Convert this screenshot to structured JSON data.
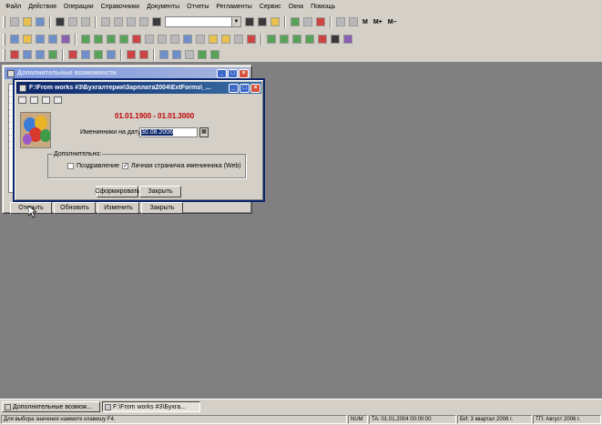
{
  "menubar": {
    "items": [
      "Файл",
      "Действия",
      "Операции",
      "Справочники",
      "Документы",
      "Отчеты",
      "Регламенты",
      "Сервис",
      "Окна",
      "Помощь"
    ]
  },
  "toolbar": {
    "m_label": "M",
    "m_plus_label": "M+",
    "m_minus_label": "M–"
  },
  "back_window": {
    "title": "Дополнительные возможности",
    "buttons": [
      "Открыть",
      "Обновить",
      "Изменить",
      "Закрыть"
    ]
  },
  "dialog": {
    "title": "F:\\From works #3\\Бухгалтерия\\Зарплата2004\\ExtForms\\_...",
    "date_range": "01.01.1900 - 01.01.3000",
    "birthday_label": "Именинники на дату:",
    "date_value": "30.08.2006",
    "group_label": "Дополнительно:",
    "greeting_label": "Поздравление",
    "greeting_checked": false,
    "personal_page_label": "Личная страничка именинника (Web)",
    "personal_page_checked": true,
    "form_button": "Сформировать",
    "close_button": "Закрыть"
  },
  "taskbar": {
    "items": [
      "Дополнительные возмож...",
      "F:\\From works #3\\Бухга..."
    ]
  },
  "statusbar": {
    "hint": "Для выбора значения нажмите клавишу F4.",
    "num": "NUM",
    "ta": "TA: 01.01.2004  00:00:00",
    "bi": "БИ: 3 квартал 2006 г.",
    "tp": "ТП: Август 2006 г."
  }
}
